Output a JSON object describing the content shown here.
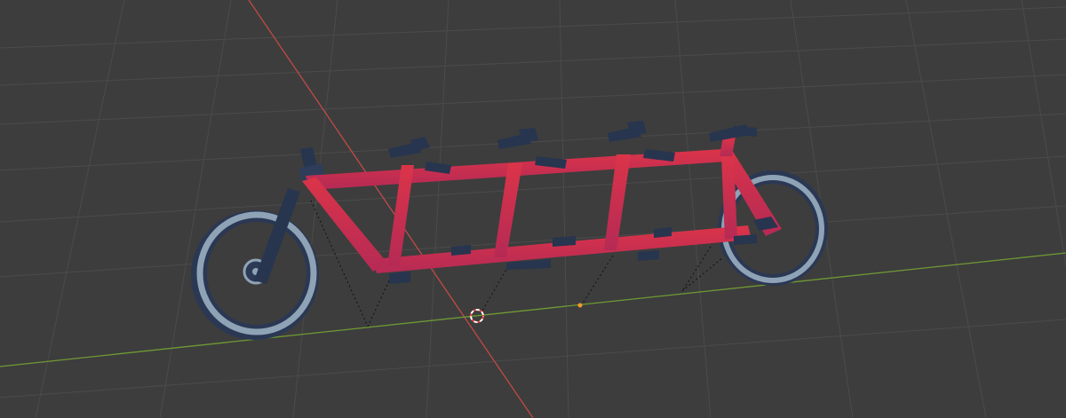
{
  "viewport": {
    "background_color": "#3d3d3d",
    "grid_color": "#4e4e4e",
    "x_axis_color": "#c04a46",
    "y_axis_color": "#6f9a34"
  },
  "model": {
    "frame_color": "#d3324a",
    "frame_shade_color": "#b3284f",
    "tire_color": "#2d3a55",
    "rim_color": "#8fa2b4",
    "component_color": "#27354f",
    "rider_seats": 4
  },
  "icons": {
    "cursor": "3d-cursor-icon",
    "origin": "object-origin-icon"
  }
}
